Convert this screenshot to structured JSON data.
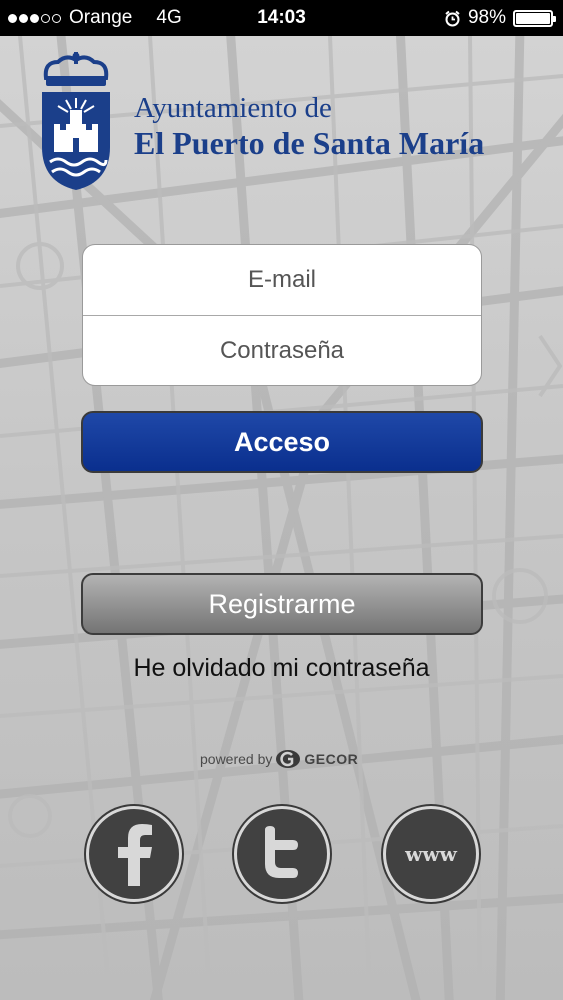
{
  "status_bar": {
    "carrier": "Orange",
    "network": "4G",
    "time": "14:03",
    "battery": "98%",
    "signal_bars_filled": 3,
    "signal_bars_total": 5
  },
  "header": {
    "line1": "Ayuntamiento de",
    "line2": "El Puerto de Santa María"
  },
  "login": {
    "email_placeholder": "E-mail",
    "password_placeholder": "Contraseña",
    "email_value": "",
    "password_value": ""
  },
  "buttons": {
    "acceso": "Acceso",
    "registrarme": "Registrarme"
  },
  "forgot_password": "He olvidado mi contraseña",
  "powered_by": {
    "label": "powered by",
    "brand": "GECOR"
  },
  "social": {
    "www_label": "www",
    "icons": [
      "facebook-icon",
      "twitter-icon",
      "www-icon"
    ]
  },
  "colors": {
    "brand_blue": "#1b3f8a",
    "button_blue": "#0a2f8e",
    "button_gray": "#8a8a8a",
    "social_dark": "#414141"
  }
}
